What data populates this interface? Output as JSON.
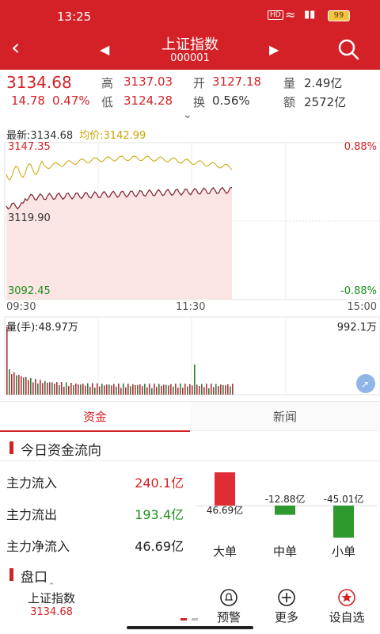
{
  "status_bar": {
    "time": "13:25",
    "battery": "99",
    "hd": "HD"
  },
  "header": {
    "title": "上证指数",
    "code": "000001"
  },
  "quote": {
    "price": "3134.68",
    "change": "14.78",
    "change_pct": "0.47%",
    "high_label": "高",
    "high": "3137.03",
    "low_label": "低",
    "low": "3124.28",
    "open_label": "开",
    "open": "3127.18",
    "turnover_label": "换",
    "turnover": "0.56%",
    "volume_label": "量",
    "volume": "2.49亿",
    "amount_label": "额",
    "amount": "2572亿"
  },
  "chart": {
    "latest_label": "最新:3134.68",
    "avg_label": "均价:3142.99",
    "y_top": "3147.35",
    "y_mid": "3119.90",
    "y_bottom": "3092.45",
    "pct_top": "0.88%",
    "pct_bottom": "-0.88%",
    "t_start": "09:30",
    "t_mid": "11:30",
    "t_end": "15:00",
    "vol_label": "量(手):48.97万",
    "vol_max": "992.1万",
    "colors": {
      "price": "#7a1f2b",
      "avg": "#c9a300",
      "fill": "#fbe4e4",
      "vol_up": "#b03040",
      "vol_down": "#2e7d32"
    }
  },
  "tabs": [
    {
      "label": "资金"
    },
    {
      "label": "新闻"
    }
  ],
  "capital": {
    "title": "今日资金流向",
    "rows": [
      {
        "label": "主力流入",
        "value": "240.1亿"
      },
      {
        "label": "主力流出",
        "value": "193.4亿"
      },
      {
        "label": "主力净流入",
        "value": "46.69亿"
      }
    ],
    "bars": [
      {
        "label": "大单",
        "value_text": "46.69亿",
        "value": 46.69
      },
      {
        "label": "中单",
        "value_text": "-12.88亿",
        "value": -12.88
      },
      {
        "label": "小单",
        "value_text": "-45.01亿",
        "value": -45.01
      }
    ]
  },
  "pankou": {
    "title": "盘口"
  },
  "bottom_nav": {
    "stock_name": "上证指数",
    "stock_price": "3134.68",
    "alert_label": "预警",
    "more_label": "更多",
    "watch_label": "设自选"
  }
}
